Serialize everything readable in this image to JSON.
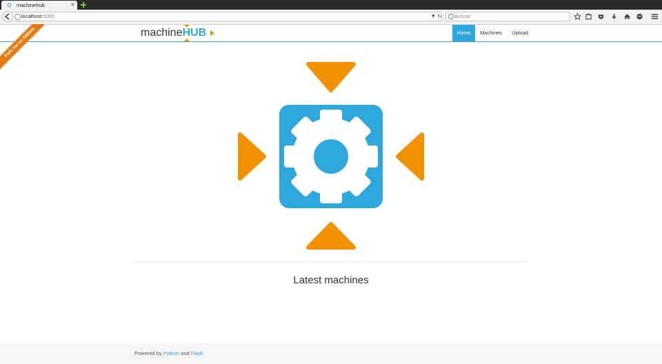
{
  "browser": {
    "tab_title": "machinehub",
    "url_host": "localhost",
    "url_port": ":5000",
    "search_placeholder": "Buscar"
  },
  "site": {
    "brand_part1": "machine",
    "brand_part2": "HUB",
    "nav": [
      {
        "label": "Home",
        "active": true
      },
      {
        "label": "Machines",
        "active": false
      },
      {
        "label": "Upload",
        "active": false
      }
    ],
    "ribbon": "Fork me on GitHub",
    "section_title": "Latest machines",
    "footer": {
      "prefix": "Powered by",
      "link1": "Python",
      "middle": "and",
      "link2": "Flask"
    },
    "colors": {
      "accent": "#2ea8dc",
      "arrow": "#f39200",
      "ribbon": "#e67a0e"
    }
  }
}
